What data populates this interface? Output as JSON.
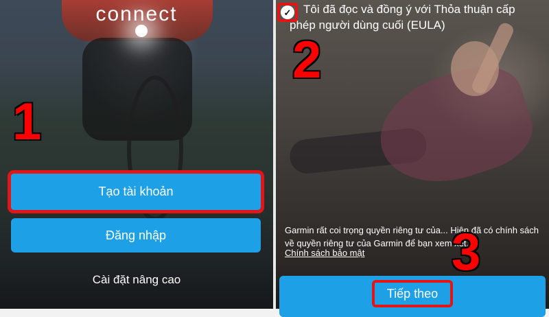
{
  "left_screen": {
    "logo": "connect",
    "step_number": "1",
    "buttons": {
      "create_account": "Tạo tài khoản",
      "login": "Đăng nhập"
    },
    "advanced_settings": "Cài đặt nâng cao"
  },
  "right_screen": {
    "step_number_checkbox": "2",
    "step_number_next": "3",
    "eula": {
      "checked": true,
      "text": "Tôi đã đọc và đồng ý với Thỏa thuận cấp phép người dùng cuối (EULA)"
    },
    "privacy_notice": "Garmin rất coi trọng quyền riêng tư của... Hiện đã có chính sách về quyền riêng tư của Garmin để bạn xem xét.",
    "privacy_link": "Chính sách bảo mật",
    "next_button": "Tiếp theo"
  },
  "colors": {
    "button_blue": "#1ea0e6",
    "highlight_red": "#e21616"
  }
}
